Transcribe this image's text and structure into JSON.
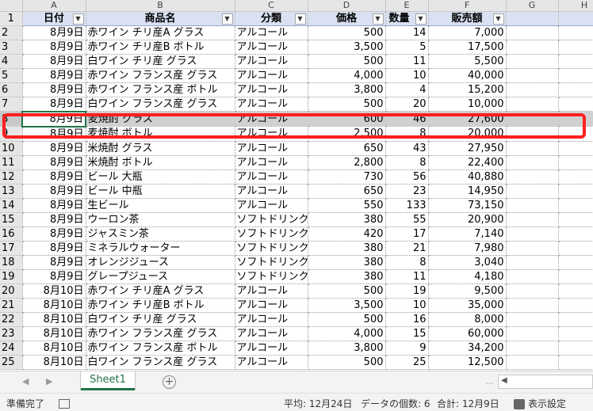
{
  "columns": {
    "A": "A",
    "B": "B",
    "C": "C",
    "D": "D",
    "E": "E",
    "F": "F",
    "G": "G",
    "H": "H"
  },
  "header": {
    "rownum": "1",
    "date": "日付",
    "product": "商品名",
    "category": "分類",
    "price": "価格",
    "qty": "数量",
    "sales": "販売額",
    "dropdown": "▼"
  },
  "rows": [
    {
      "n": "2",
      "date": "8月9日",
      "product": "赤ワイン チリ産A グラス",
      "category": "アルコール",
      "price": "500",
      "qty": "14",
      "sales": "7,000"
    },
    {
      "n": "3",
      "date": "8月9日",
      "product": "赤ワイン チリ産B ボトル",
      "category": "アルコール",
      "price": "3,500",
      "qty": "5",
      "sales": "17,500"
    },
    {
      "n": "4",
      "date": "8月9日",
      "product": "白ワイン チリ産 グラス",
      "category": "アルコール",
      "price": "500",
      "qty": "11",
      "sales": "5,500"
    },
    {
      "n": "5",
      "date": "8月9日",
      "product": "赤ワイン フランス産 グラス",
      "category": "アルコール",
      "price": "4,000",
      "qty": "10",
      "sales": "40,000"
    },
    {
      "n": "6",
      "date": "8月9日",
      "product": "赤ワイン フランス産 ボトル",
      "category": "アルコール",
      "price": "3,800",
      "qty": "4",
      "sales": "15,200"
    },
    {
      "n": "7",
      "date": "8月9日",
      "product": "白ワイン フランス産 グラス",
      "category": "アルコール",
      "price": "500",
      "qty": "20",
      "sales": "10,000"
    },
    {
      "n": "8",
      "date": "8月9日",
      "product": "麦焼酎 グラス",
      "category": "アルコール",
      "price": "600",
      "qty": "46",
      "sales": "27,600"
    },
    {
      "n": "9",
      "date": "8月9日",
      "product": "麦焼酎 ボトル",
      "category": "アルコール",
      "price": "2,500",
      "qty": "8",
      "sales": "20,000"
    },
    {
      "n": "10",
      "date": "8月9日",
      "product": "米焼酎 グラス",
      "category": "アルコール",
      "price": "650",
      "qty": "43",
      "sales": "27,950"
    },
    {
      "n": "11",
      "date": "8月9日",
      "product": "米焼酎 ボトル",
      "category": "アルコール",
      "price": "2,800",
      "qty": "8",
      "sales": "22,400"
    },
    {
      "n": "12",
      "date": "8月9日",
      "product": "ビール 大瓶",
      "category": "アルコール",
      "price": "730",
      "qty": "56",
      "sales": "40,880"
    },
    {
      "n": "13",
      "date": "8月9日",
      "product": "ビール 中瓶",
      "category": "アルコール",
      "price": "650",
      "qty": "23",
      "sales": "14,950"
    },
    {
      "n": "14",
      "date": "8月9日",
      "product": "生ビール",
      "category": "アルコール",
      "price": "550",
      "qty": "133",
      "sales": "73,150"
    },
    {
      "n": "15",
      "date": "8月9日",
      "product": "ウーロン茶",
      "category": "ソフトドリンク",
      "price": "380",
      "qty": "55",
      "sales": "20,900"
    },
    {
      "n": "16",
      "date": "8月9日",
      "product": "ジャスミン茶",
      "category": "ソフトドリンク",
      "price": "420",
      "qty": "17",
      "sales": "7,140"
    },
    {
      "n": "17",
      "date": "8月9日",
      "product": "ミネラルウォーター",
      "category": "ソフトドリンク",
      "price": "380",
      "qty": "21",
      "sales": "7,980"
    },
    {
      "n": "18",
      "date": "8月9日",
      "product": "オレンジジュース",
      "category": "ソフトドリンク",
      "price": "380",
      "qty": "8",
      "sales": "3,040"
    },
    {
      "n": "19",
      "date": "8月9日",
      "product": "グレープジュース",
      "category": "ソフトドリンク",
      "price": "380",
      "qty": "11",
      "sales": "4,180"
    },
    {
      "n": "20",
      "date": "8月10日",
      "product": "赤ワイン チリ産A グラス",
      "category": "アルコール",
      "price": "500",
      "qty": "19",
      "sales": "9,500"
    },
    {
      "n": "21",
      "date": "8月10日",
      "product": "赤ワイン チリ産B ボトル",
      "category": "アルコール",
      "price": "3,500",
      "qty": "10",
      "sales": "35,000"
    },
    {
      "n": "22",
      "date": "8月10日",
      "product": "白ワイン チリ産 グラス",
      "category": "アルコール",
      "price": "500",
      "qty": "16",
      "sales": "8,000"
    },
    {
      "n": "23",
      "date": "8月10日",
      "product": "赤ワイン フランス産 グラス",
      "category": "アルコール",
      "price": "4,000",
      "qty": "15",
      "sales": "60,000"
    },
    {
      "n": "24",
      "date": "8月10日",
      "product": "赤ワイン フランス産 ボトル",
      "category": "アルコール",
      "price": "3,800",
      "qty": "9",
      "sales": "34,200"
    },
    {
      "n": "25",
      "date": "8月10日",
      "product": "白ワイン フランス産 グラス",
      "category": "アルコール",
      "price": "500",
      "qty": "25",
      "sales": "12,500"
    }
  ],
  "selected_row": "8",
  "tabs": {
    "sheet1": "Sheet1",
    "add": "+",
    "prev": "◀",
    "next": "▶",
    "more": "…",
    "scroll_left": "◀"
  },
  "status": {
    "ready": "準備完了",
    "average": "平均: 12月24日",
    "count": "データの個数: 6",
    "sum": "合計: 12月9日",
    "display_settings": "表示設定"
  },
  "colors": {
    "header_fill": "#d9e1f2",
    "selection_fill": "#d0d0d0",
    "highlight_border": "#ff1f1f",
    "excel_green": "#217346"
  }
}
